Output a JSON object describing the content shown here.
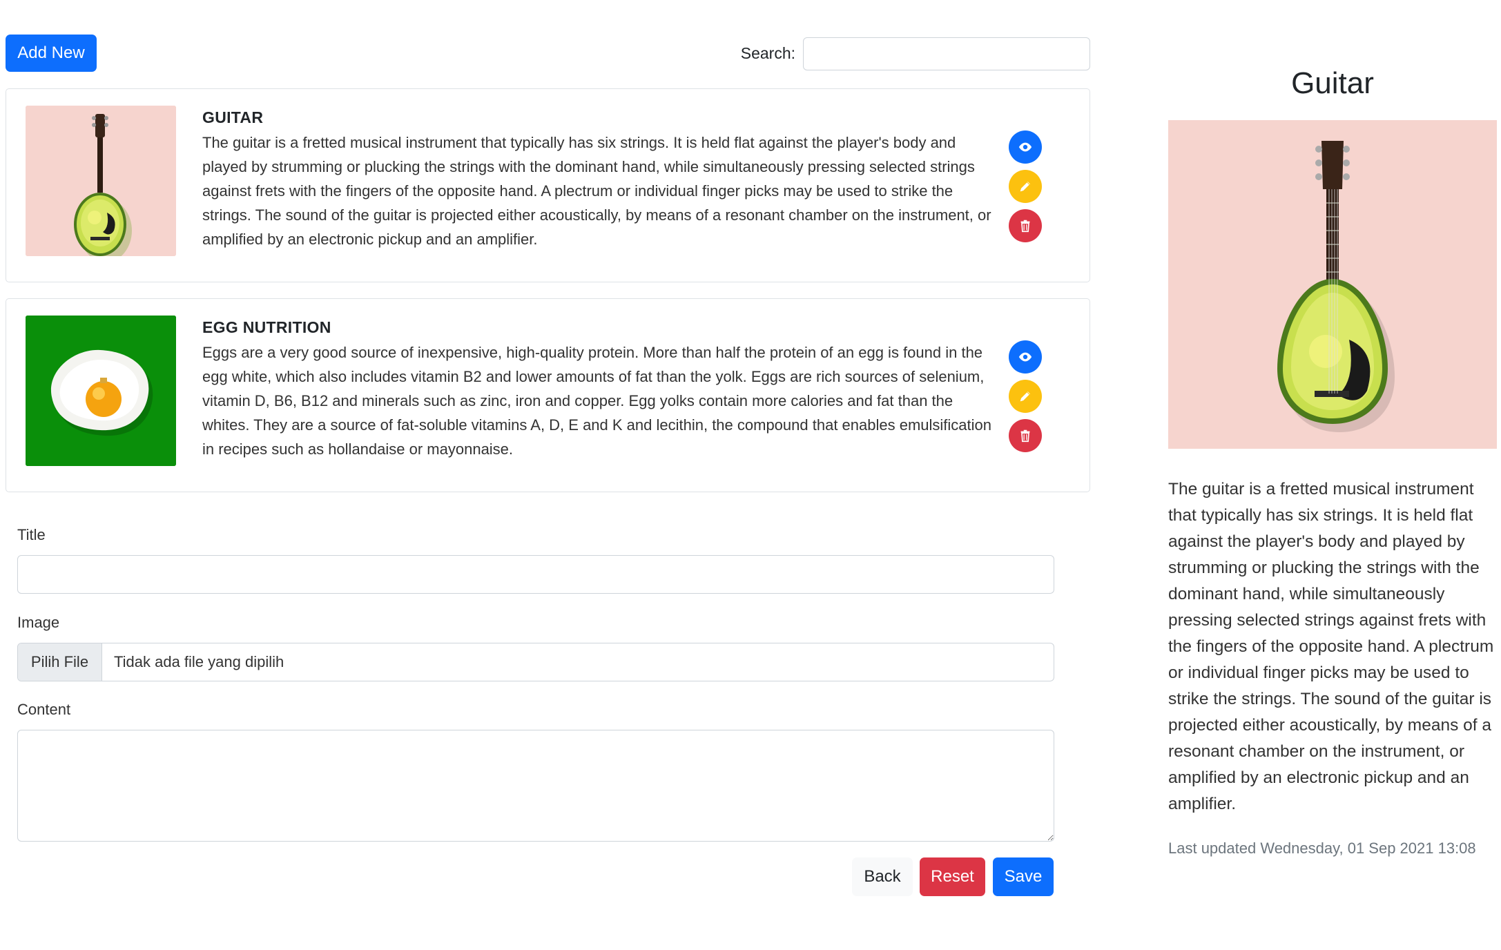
{
  "toolbar": {
    "add_new_label": "Add New",
    "search_label": "Search:",
    "search_value": ""
  },
  "items": [
    {
      "title": "GUITAR",
      "content": "The guitar is a fretted musical instrument that typically has six strings. It is held flat against the player's body and played by strumming or plucking the strings with the dominant hand, while simultaneously pressing selected strings against frets with the fingers of the opposite hand. A plectrum or individual finger picks may be used to strike the strings. The sound of the guitar is projected either acoustically, by means of a resonant chamber on the instrument, or amplified by an electronic pickup and an amplifier.",
      "image_icon": "avocado-guitar-image"
    },
    {
      "title": "EGG NUTRITION",
      "content": "Eggs are a very good source of inexpensive, high-quality protein. More than half the protein of an egg is found in the egg white, which also includes vitamin B2 and lower amounts of fat than the yolk. Eggs are rich sources of selenium, vitamin D, B6, B12 and minerals such as zinc, iron and copper. Egg yolks contain more calories and fat than the whites. They are a source of fat-soluble vitamins A, D, E and K and lecithin, the compound that enables emulsification in recipes such as hollandaise or mayonnaise.",
      "image_icon": "fried-egg-ornament-image"
    }
  ],
  "action_icons": [
    "eye-icon",
    "pencil-icon",
    "trash-icon"
  ],
  "form": {
    "title_label": "Title",
    "title_value": "",
    "image_label": "Image",
    "file_button_label": "Pilih File",
    "file_status": "Tidak ada file yang dipilih",
    "content_label": "Content",
    "content_value": "",
    "back_label": "Back",
    "reset_label": "Reset",
    "save_label": "Save"
  },
  "detail": {
    "title": "Guitar",
    "content": "The guitar is a fretted musical instrument that typically has six strings. It is held flat against the player's body and played by strumming or plucking the strings with the dominant hand, while simultaneously pressing selected strings against frets with the fingers of the opposite hand. A plectrum or individual finger picks may be used to strike the strings. The sound of the guitar is projected either acoustically, by means of a resonant chamber on the instrument, or amplified by an electronic pickup and an amplifier.",
    "last_updated": "Last updated Wednesday, 01 Sep 2021 13:08"
  },
  "colors": {
    "primary": "#0d6efd",
    "warning": "#fcc10f",
    "danger": "#dc3545",
    "image_bg_pink": "#f6d4ce",
    "image_bg_green": "#0a8f0a"
  }
}
